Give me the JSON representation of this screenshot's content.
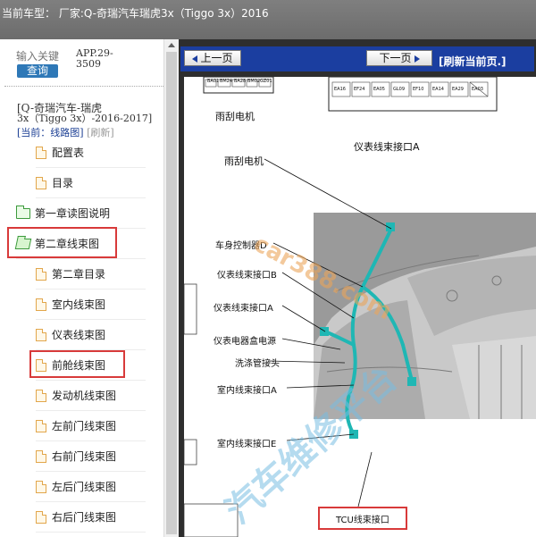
{
  "topbar": {
    "title": "当前车型：   厂家:Q-奇瑞汽车瑞虎3x（Tiggo 3x）2016"
  },
  "search": {
    "placeholder": "输入关键",
    "button": "查询"
  },
  "app_code": "APP.29-3509",
  "car_info": {
    "line1": "[Q-奇瑞汽车-瑞虎",
    "line2": "3x（Tiggo 3x）-2016-2017]",
    "current_label": "[当前：线路图]",
    "refresh": "[刷新]"
  },
  "tree": [
    {
      "label": "配置表",
      "icon": "document-icon"
    },
    {
      "label": "目录",
      "icon": "document-icon"
    },
    {
      "label": "第一章读图说明",
      "icon": "folder-icon"
    },
    {
      "label": "第二章线束图",
      "icon": "folder-open-icon"
    },
    {
      "label": "第二章目录",
      "icon": "document-icon"
    },
    {
      "label": "室内线束图",
      "icon": "document-icon"
    },
    {
      "label": "仪表线束图",
      "icon": "document-icon"
    },
    {
      "label": "前舱线束图",
      "icon": "document-icon"
    },
    {
      "label": "发动机线束图",
      "icon": "document-icon"
    },
    {
      "label": "左前门线束图",
      "icon": "document-icon"
    },
    {
      "label": "右前门线束图",
      "icon": "document-icon"
    },
    {
      "label": "左后门线束图",
      "icon": "document-icon"
    },
    {
      "label": "右后门线束图",
      "icon": "document-icon"
    }
  ],
  "nav": {
    "prev": "上一页",
    "next": "下一页",
    "refresh": "[刷新当前页.]"
  },
  "diagram": {
    "labels": {
      "wiper_motor_1": "雨刮电机",
      "instrument_a_top": "仪表线束接口A",
      "wiper_motor_2": "雨刮电机",
      "body_control": "车身控制器D",
      "instrument_b": "仪表线束接口B",
      "instrument_a": "仪表线束接口A",
      "instrument_power": "仪表电器盒电源",
      "washer": "洗涤管接头",
      "indoor_a": "室内线束接口A",
      "indoor_e": "室内线束接口E",
      "tcu": "TCU线束接口"
    },
    "top_connector_pins": [
      "BA01",
      "BM24",
      "BA28",
      "BM02",
      "GZ01"
    ],
    "right_connector_pins": [
      "EA16",
      "EF24",
      "EA05",
      "GL09",
      "EF10",
      "EA14",
      "EA29",
      "EA03"
    ],
    "watermarks": {
      "site": "car388.com",
      "platform": "汽车维修平台"
    }
  }
}
